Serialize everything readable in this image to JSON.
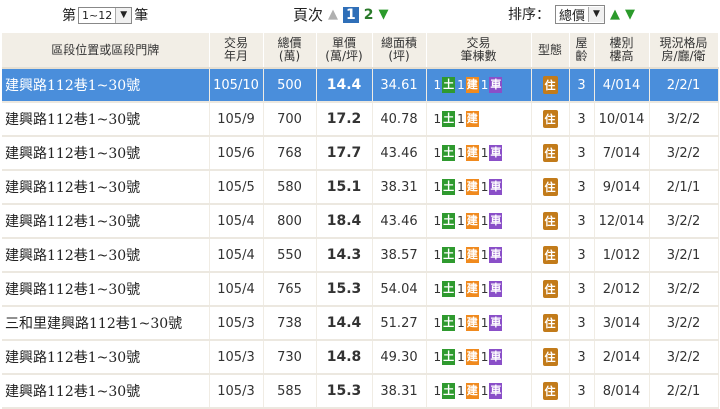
{
  "top": {
    "prefix": "第",
    "range_value": "1~12",
    "suffix": "筆",
    "pages_label": "頁次",
    "page_current": "1",
    "page_next": "2",
    "sort_label": "排序：",
    "sort_value": "總價"
  },
  "columns": {
    "addr": "區段位置或區段門牌",
    "date": "交易\n年月",
    "total": "總價\n(萬)",
    "unit": "單價\n(萬/坪)",
    "area": "總面積\n(坪)",
    "deal": "交易\n筆棟數",
    "type": "型態",
    "age": "屋\n齡",
    "floor": "樓別\n樓高",
    "layout": "現況格局\n房/廳/衛"
  },
  "badge_labels": {
    "land": "土",
    "building": "建",
    "car": "車",
    "type": "住"
  },
  "colors": {
    "selected_row": "#4a8edb",
    "land": "#2f9a2f",
    "building": "#f08a1e",
    "car": "#8a4fc8",
    "header_bg": "#f2eee6"
  },
  "rows": [
    {
      "addr": "建興路112巷1~30號",
      "date": "105/10",
      "total": "500",
      "unit": "14.4",
      "area": "34.61",
      "land": "1",
      "building": "1",
      "car": "1",
      "type": "住",
      "age": "3",
      "floor": "4/014",
      "layout": "2/2/1",
      "selected": true
    },
    {
      "addr": "建興路112巷1~30號",
      "date": "105/9",
      "total": "700",
      "unit": "17.2",
      "area": "40.78",
      "land": "1",
      "building": "1",
      "car": "",
      "type": "住",
      "age": "3",
      "floor": "10/014",
      "layout": "3/2/2",
      "selected": false
    },
    {
      "addr": "建興路112巷1~30號",
      "date": "105/6",
      "total": "768",
      "unit": "17.7",
      "area": "43.46",
      "land": "1",
      "building": "1",
      "car": "1",
      "type": "住",
      "age": "3",
      "floor": "7/014",
      "layout": "3/2/2",
      "selected": false
    },
    {
      "addr": "建興路112巷1~30號",
      "date": "105/5",
      "total": "580",
      "unit": "15.1",
      "area": "38.31",
      "land": "1",
      "building": "1",
      "car": "1",
      "type": "住",
      "age": "3",
      "floor": "9/014",
      "layout": "2/1/1",
      "selected": false
    },
    {
      "addr": "建興路112巷1~30號",
      "date": "105/4",
      "total": "800",
      "unit": "18.4",
      "area": "43.46",
      "land": "1",
      "building": "1",
      "car": "1",
      "type": "住",
      "age": "3",
      "floor": "12/014",
      "layout": "3/2/2",
      "selected": false
    },
    {
      "addr": "建興路112巷1~30號",
      "date": "105/4",
      "total": "550",
      "unit": "14.3",
      "area": "38.57",
      "land": "1",
      "building": "1",
      "car": "1",
      "type": "住",
      "age": "3",
      "floor": "1/012",
      "layout": "3/2/1",
      "selected": false
    },
    {
      "addr": "建興路112巷1~30號",
      "date": "105/4",
      "total": "765",
      "unit": "15.3",
      "area": "54.04",
      "land": "1",
      "building": "1",
      "car": "1",
      "type": "住",
      "age": "3",
      "floor": "2/012",
      "layout": "3/2/2",
      "selected": false
    },
    {
      "addr": "三和里建興路112巷1~30號",
      "date": "105/3",
      "total": "738",
      "unit": "14.4",
      "area": "51.27",
      "land": "1",
      "building": "1",
      "car": "1",
      "type": "住",
      "age": "3",
      "floor": "3/014",
      "layout": "3/2/2",
      "selected": false
    },
    {
      "addr": "建興路112巷1~30號",
      "date": "105/3",
      "total": "730",
      "unit": "14.8",
      "area": "49.30",
      "land": "1",
      "building": "1",
      "car": "1",
      "type": "住",
      "age": "3",
      "floor": "2/014",
      "layout": "3/2/2",
      "selected": false
    },
    {
      "addr": "建興路112巷1~30號",
      "date": "105/3",
      "total": "585",
      "unit": "15.3",
      "area": "38.31",
      "land": "1",
      "building": "1",
      "car": "1",
      "type": "住",
      "age": "3",
      "floor": "8/014",
      "layout": "2/2/1",
      "selected": false
    }
  ]
}
